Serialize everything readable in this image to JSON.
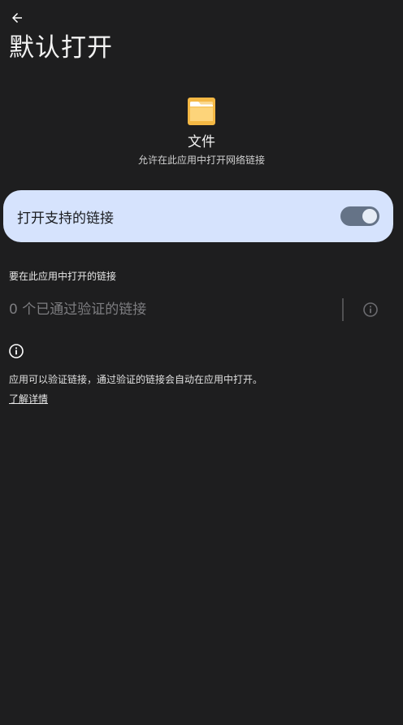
{
  "header": {
    "title": "默认打开"
  },
  "app": {
    "name": "文件",
    "description": "允许在此应用中打开网络链接"
  },
  "open_links_toggle": {
    "label": "打开支持的链接",
    "enabled": true
  },
  "links_section": {
    "title": "要在此应用中打开的链接",
    "verified_links_text": "0 个已通过验证的链接"
  },
  "footer": {
    "info_text": "应用可以验证链接，通过验证的链接会自动在应用中打开。",
    "learn_more_label": "了解详情"
  },
  "colors": {
    "background": "#1e1e1f",
    "card": "#d6e3fd",
    "switch_track": "#657387",
    "switch_knob": "#e6ecf6",
    "folder_icon": "#f4b844"
  }
}
